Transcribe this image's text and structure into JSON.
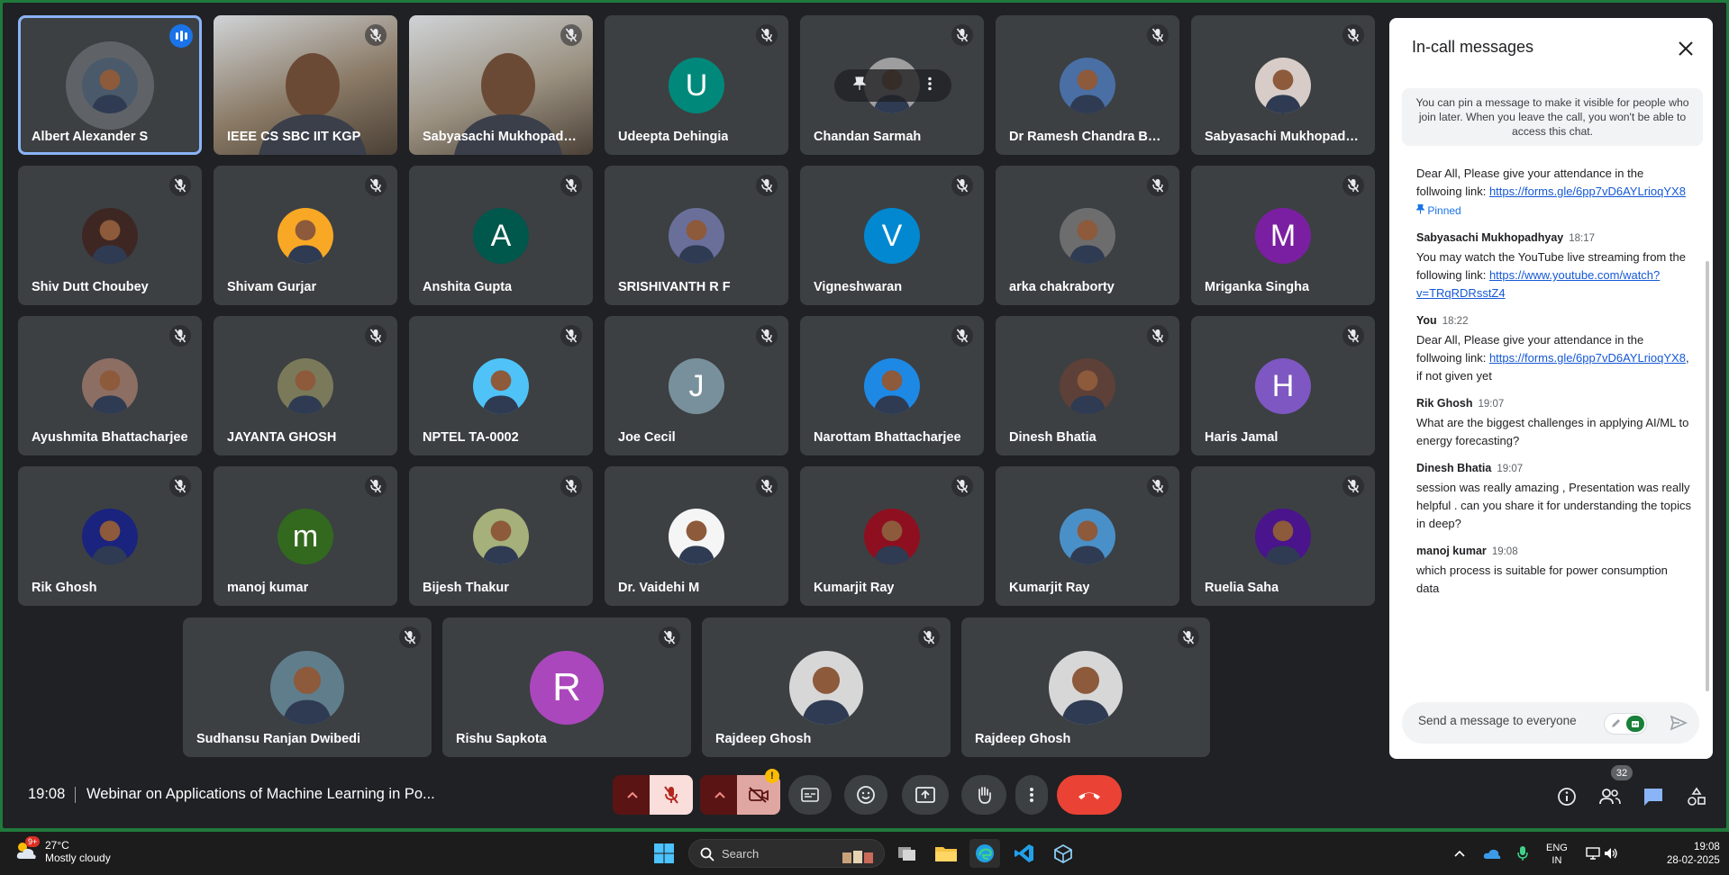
{
  "meeting": {
    "time": "19:08",
    "title": "Webinar on Applications of Machine Learning in Po..."
  },
  "participants_count": "32",
  "tiles": [
    {
      "name": "Albert Alexander S",
      "type": "photo",
      "color": "#4a5a6a"
    },
    {
      "name": "IEEE CS SBC IIT KGP",
      "type": "video",
      "color": "#8a7a66"
    },
    {
      "name": "Sabyasachi Mukhopadh...",
      "type": "video",
      "color": "#9a9080"
    },
    {
      "name": "Udeepta Dehingia",
      "type": "letter",
      "letter": "U",
      "color": "#00897b"
    },
    {
      "name": "Chandan Sarmah",
      "type": "photo",
      "color": "#9e9e9e"
    },
    {
      "name": "Dr Ramesh Chandra Bor...",
      "type": "photo",
      "color": "#4a6fa5"
    },
    {
      "name": "Sabyasachi Mukhopadh...",
      "type": "photo",
      "color": "#d7ccc8"
    },
    {
      "name": "Shiv Dutt Choubey",
      "type": "photo",
      "color": "#3e2723"
    },
    {
      "name": "Shivam Gurjar",
      "type": "photo",
      "color": "#f9a825"
    },
    {
      "name": "Anshita Gupta",
      "type": "letter",
      "letter": "A",
      "color": "#00574b"
    },
    {
      "name": "SRISHIVANTH R F",
      "type": "photo",
      "color": "#6a6f9a"
    },
    {
      "name": "Vigneshwaran",
      "type": "letter",
      "letter": "V",
      "color": "#0288d1"
    },
    {
      "name": "arka chakraborty",
      "type": "photo",
      "color": "#6d6d6d"
    },
    {
      "name": "Mriganka Singha",
      "type": "letter",
      "letter": "M",
      "color": "#7b1fa2"
    },
    {
      "name": "Ayushmita Bhattacharjee",
      "type": "photo",
      "color": "#8d6e63"
    },
    {
      "name": "JAYANTA GHOSH",
      "type": "photo",
      "color": "#7a7a5a"
    },
    {
      "name": "NPTEL TA-0002",
      "type": "photo",
      "color": "#4fc3f7"
    },
    {
      "name": "Joe Cecil",
      "type": "letter",
      "letter": "J",
      "color": "#78909c"
    },
    {
      "name": "Narottam Bhattacharjee",
      "type": "photo",
      "color": "#1e88e5"
    },
    {
      "name": "Dinesh Bhatia",
      "type": "photo",
      "color": "#5d4037"
    },
    {
      "name": "Haris Jamal",
      "type": "letter",
      "letter": "H",
      "color": "#7e57c2"
    },
    {
      "name": "Rik Ghosh",
      "type": "photo",
      "color": "#1a237e"
    },
    {
      "name": "manoj kumar",
      "type": "letter",
      "letter": "m",
      "color": "#33691e"
    },
    {
      "name": "Bijesh Thakur",
      "type": "photo",
      "color": "#a5b07a"
    },
    {
      "name": "Dr. Vaidehi M",
      "type": "photo",
      "color": "#f5f5f5"
    },
    {
      "name": "Kumarjit Ray",
      "type": "photo",
      "color": "#8e1020"
    },
    {
      "name": "Kumarjit Ray",
      "type": "photo",
      "color": "#4a90c8"
    },
    {
      "name": "Ruelia Saha",
      "type": "photo",
      "color": "#4a148c"
    },
    {
      "name": "Sudhansu Ranjan Dwibedi",
      "type": "photo",
      "color": "#607d8b"
    },
    {
      "name": "Rishu Sapkota",
      "type": "letter",
      "letter": "R",
      "color": "#ab47bc"
    },
    {
      "name": "Rajdeep Ghosh",
      "type": "photo",
      "color": "#d7d7d7"
    },
    {
      "name": "Rajdeep Ghosh",
      "type": "photo",
      "color": "#d7d7d7"
    }
  ],
  "chat": {
    "title": "In-call messages",
    "notice": "You can pin a message to make it visible for people who join later. When you leave the call, you won't be able to access this chat.",
    "pinned_label": "Pinned",
    "messages": [
      {
        "sender": "",
        "time": "",
        "text": "Dear All, Please give your attendance in the follwoing link:",
        "link": "https://forms.gle/6pp7vD6AYLrioqYX8",
        "after": ""
      },
      {
        "sender": "Sabyasachi Mukhopadhyay",
        "time": "18:17",
        "text": "You may watch the YouTube live streaming from the following link:",
        "link": "https://www.youtube.com/watch?v=TRqRDRsstZ4",
        "after": ""
      },
      {
        "sender": "You",
        "time": "18:22",
        "text": "Dear All, Please give your attendance in the follwoing link:",
        "link": "https://forms.gle/6pp7vD6AYLrioqYX8",
        "after": ", if not given yet"
      },
      {
        "sender": "Rik Ghosh",
        "time": "19:07",
        "text": "What are the biggest challenges in applying AI/ML to energy forecasting?",
        "link": "",
        "after": ""
      },
      {
        "sender": "Dinesh Bhatia",
        "time": "19:07",
        "text": "session was really amazing , Presentation was really helpful . can you share it for understanding the topics in deep?",
        "link": "",
        "after": ""
      },
      {
        "sender": "manoj kumar",
        "time": "19:08",
        "text": "which process is suitable for power  consumption data",
        "link": "",
        "after": ""
      }
    ],
    "input_placeholder": "Send a message to everyone"
  },
  "taskbar": {
    "weather_temp": "27°C",
    "weather_desc": "Mostly cloudy",
    "weather_badge": "9+",
    "search_label": "Search",
    "lang_1": "ENG",
    "lang_2": "IN",
    "clock_time": "19:08",
    "clock_date": "28-02-2025"
  },
  "colors": {
    "background": "#202124",
    "tile": "#3c4043",
    "end_call": "#ea4335",
    "muted_btn": "#f9dedc",
    "accent": "#1a73e8"
  }
}
